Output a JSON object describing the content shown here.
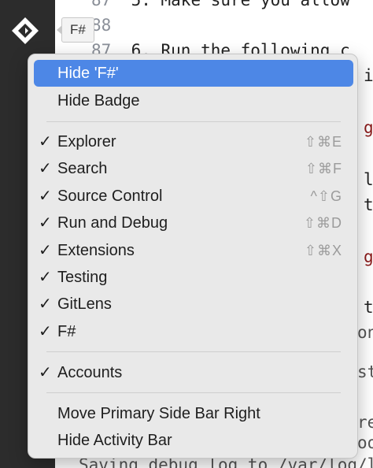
{
  "editor": {
    "lines": [
      {
        "num": "87",
        "text": "5. Make sure you allow"
      },
      {
        "num": "88",
        "text": ""
      },
      {
        "num": "87",
        "text": "6. Run the following c"
      },
      {
        "num": "",
        "text": "i"
      },
      {
        "num": "",
        "text": "g"
      },
      {
        "num": "",
        "text": "l"
      },
      {
        "num": "",
        "text": "t"
      },
      {
        "num": "",
        "text": "g"
      },
      {
        "num": "",
        "text": "t"
      },
      {
        "num": "",
        "text": "on"
      },
      {
        "num": "",
        "text": "st"
      },
      {
        "num": "",
        "text": "re"
      },
      {
        "num": "",
        "text": "oo"
      },
      {
        "num": "",
        "text": "Saving debug log to /var/log/l"
      }
    ]
  },
  "activity_bar": {
    "fsharp_tooltip": "F#"
  },
  "menu": {
    "items": [
      {
        "label": "Hide 'F#'",
        "check": "",
        "shortcut": ""
      },
      {
        "label": "Hide Badge",
        "check": "",
        "shortcut": ""
      },
      {
        "label": "Explorer",
        "check": "✓",
        "shortcut": "⇧⌘E"
      },
      {
        "label": "Search",
        "check": "✓",
        "shortcut": "⇧⌘F"
      },
      {
        "label": "Source Control",
        "check": "✓",
        "shortcut": "^⇧G"
      },
      {
        "label": "Run and Debug",
        "check": "✓",
        "shortcut": "⇧⌘D"
      },
      {
        "label": "Extensions",
        "check": "✓",
        "shortcut": "⇧⌘X"
      },
      {
        "label": "Testing",
        "check": "✓",
        "shortcut": ""
      },
      {
        "label": "GitLens",
        "check": "✓",
        "shortcut": ""
      },
      {
        "label": "F#",
        "check": "✓",
        "shortcut": ""
      },
      {
        "label": "Accounts",
        "check": "✓",
        "shortcut": ""
      },
      {
        "label": "Move Primary Side Bar Right",
        "check": "",
        "shortcut": ""
      },
      {
        "label": "Hide Activity Bar",
        "check": "",
        "shortcut": ""
      }
    ]
  }
}
